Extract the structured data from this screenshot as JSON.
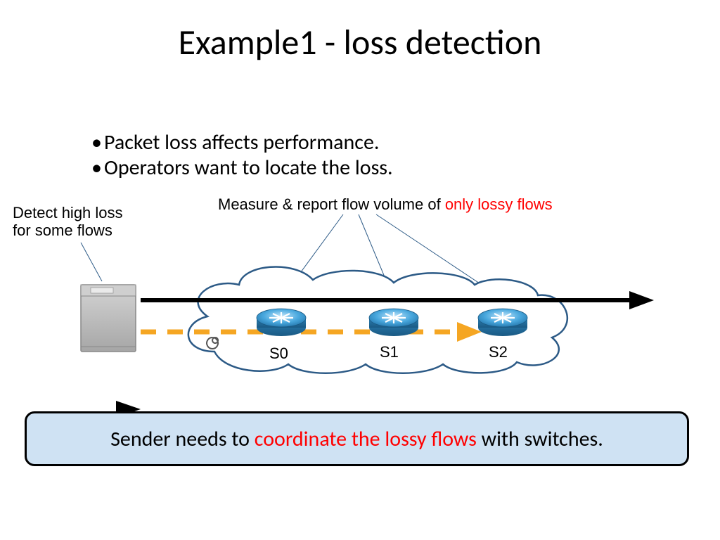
{
  "title": "Example1 - loss detection",
  "bullets": [
    "Packet loss affects performance.",
    "Operators want to locate the loss."
  ],
  "annotations": {
    "detect_line1": "Detect high loss",
    "detect_line2": "for some flows",
    "measure_pre": "Measure & report flow volume of ",
    "measure_red": "only lossy flows"
  },
  "switch_labels": {
    "s0": "S0",
    "s1": "S1",
    "s2": "S2"
  },
  "callout": {
    "pre": "Sender needs to ",
    "red": "coordinate the lossy flows",
    "post": " with switches."
  },
  "colors": {
    "accent_red": "#ff0000",
    "orange": "#f5a623",
    "cloud_stroke": "#2c5a86",
    "callout_bg": "#cfe2f3",
    "router_blue": "#3a9bd6",
    "router_blue_dark": "#2273a8",
    "server_gray": "#bfbfbf"
  }
}
